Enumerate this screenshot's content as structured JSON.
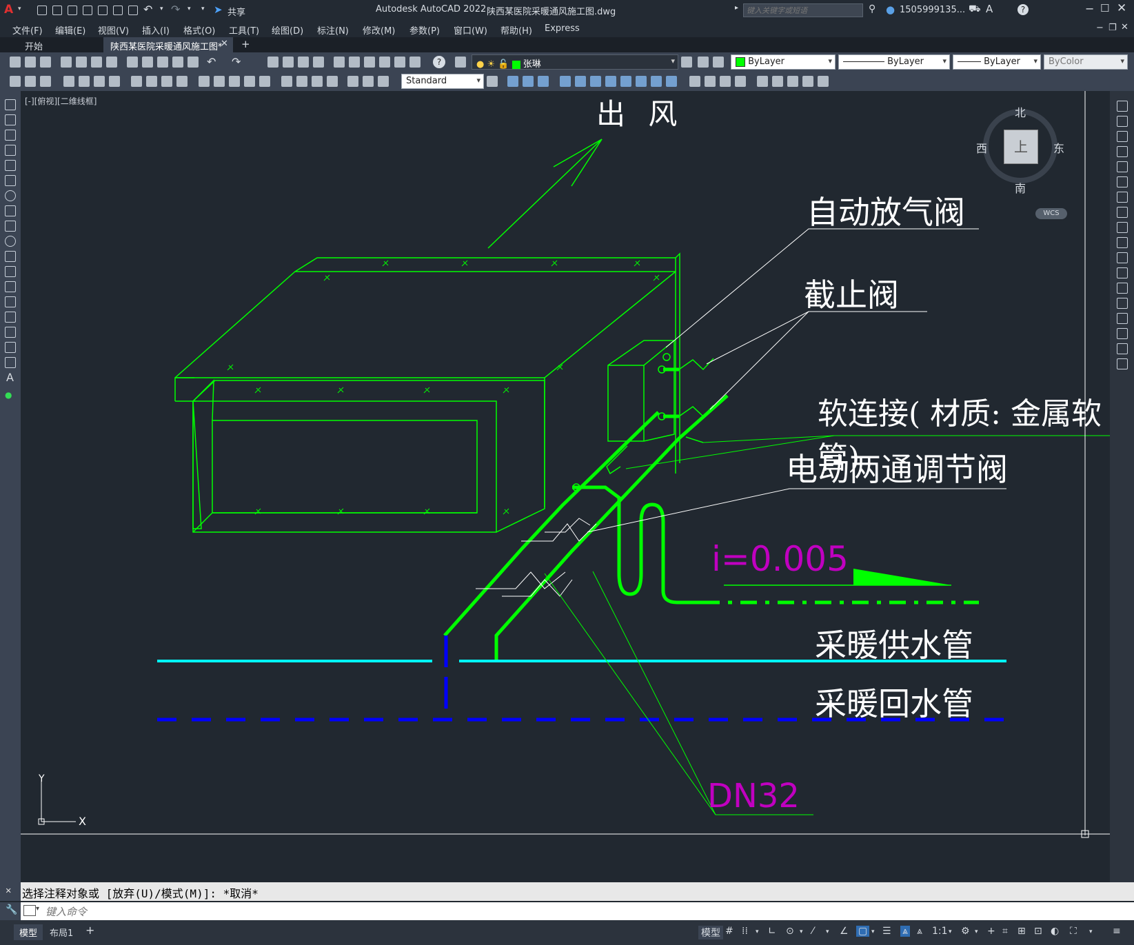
{
  "titlebar": {
    "app_title": "Autodesk AutoCAD 2022",
    "file_title": "陕西某医院采暖通风施工图.dwg",
    "share_label": "共享",
    "search_placeholder": "键入关键字或短语",
    "user": "1505999135...",
    "help": "?"
  },
  "menu": [
    "文件(F)",
    "编辑(E)",
    "视图(V)",
    "插入(I)",
    "格式(O)",
    "工具(T)",
    "绘图(D)",
    "标注(N)",
    "修改(M)",
    "参数(P)",
    "窗口(W)",
    "帮助(H)",
    "Express"
  ],
  "tabs": {
    "start": "开始",
    "doc": "陕西某医院采暖通风施工图*"
  },
  "toolbar": {
    "layer_name": "张琳",
    "color": "ByLayer",
    "linetype": "ByLayer",
    "lineweight": "ByLayer",
    "plotstyle": "ByColor",
    "text_style": "Standard"
  },
  "viewport": {
    "label": "[-][俯视][二维线框]"
  },
  "viewcube": {
    "north": "北",
    "south": "南",
    "east": "东",
    "west": "西",
    "top": "上",
    "wcs": "WCS"
  },
  "drawing": {
    "outlet_label": "出 风",
    "air_vent_label": "自动放气阀",
    "stop_valve_label": "截止阀",
    "flex_label": "软连接( 材质: 金属软管)",
    "motor_valve_label": "电动两通调节阀",
    "slope_label": "i=0.005",
    "supply_label": "采暖供水管",
    "return_label": "采暖回水管",
    "dn_label": "DN32"
  },
  "ucs": {
    "x": "X",
    "y": "Y"
  },
  "command": {
    "history": "选择注释对象或 [放弃(U)/模式(M)]: *取消*",
    "placeholder": "键入命令"
  },
  "layout_tabs": {
    "model": "模型",
    "layout1": "布局1"
  },
  "status": {
    "model": "模型",
    "scale": "1:1"
  },
  "colors": {
    "green": "#00ff00",
    "cyan": "#00ffff",
    "blue": "#0000ff",
    "magenta": "#c000c0",
    "white": "#ffffff"
  }
}
